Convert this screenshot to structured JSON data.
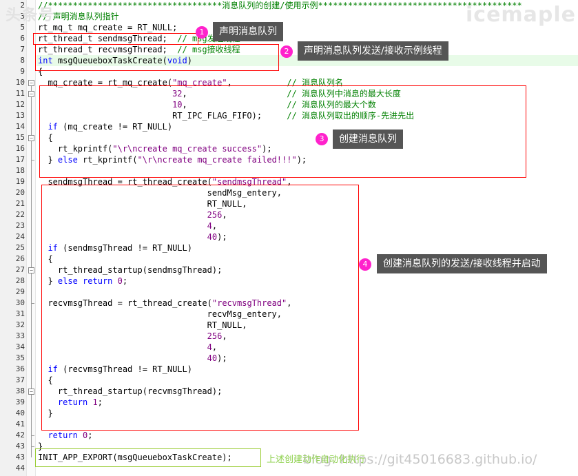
{
  "watermarks": {
    "top_left": "头条号",
    "top_right": "icemaple",
    "bottom": "blog: https://git45016683.github.io/"
  },
  "editor": {
    "lines": [
      {
        "n": "2",
        "html": "<span class=\"cmt\">//***********************************消息队列的创建/使用示例*****************************************</span>"
      },
      {
        "n": "3",
        "html": "<span class=\"cmt\">// 声明消息队列指针</span>"
      },
      {
        "n": "5",
        "html": "rt_mq_t mq_create = RT_NULL;"
      },
      {
        "n": "6",
        "html": "rt_thread_t sendmsgThread;  <span class=\"cmt\">// msg发送线程</span>"
      },
      {
        "n": "7",
        "html": "rt_thread_t recvmsgThread;  <span class=\"cmt\">// msg接收线程</span>"
      },
      {
        "n": "8",
        "html": "<span class=\"kw\">int</span> msgQueueboxTaskCreate(<span class=\"kw\">void</span>)"
      },
      {
        "n": "9",
        "html": "{"
      },
      {
        "n": "10",
        "html": "  mq_create = rt_mq_create(<span class=\"str\">\"mq_create\"</span>,           <span class=\"cmt\">// 消息队列名</span>"
      },
      {
        "n": "11",
        "html": "                           <span class=\"num\">32</span>,                    <span class=\"cmt\">// 消息队列中消息的最大长度</span>"
      },
      {
        "n": "12",
        "html": "                           <span class=\"num\">10</span>,                    <span class=\"cmt\">// 消息队列的最大个数</span>"
      },
      {
        "n": "13",
        "html": "                           RT_IPC_FLAG_FIFO);     <span class=\"cmt\">// 消息队列取出的顺序-先进先出</span>"
      },
      {
        "n": "14",
        "html": "  <span class=\"kw\">if</span> (mq_create != RT_NULL)"
      },
      {
        "n": "15",
        "html": "  {"
      },
      {
        "n": "16",
        "html": "    rt_kprintf(<span class=\"str\">\"\\r\\ncreate mq_create success\"</span>);"
      },
      {
        "n": "17",
        "html": "  } <span class=\"kw\">else</span> rt_kprintf(<span class=\"str\">\"\\r\\ncreate mq_create failed!!!\"</span>);"
      },
      {
        "n": "18",
        "html": ""
      },
      {
        "n": "19",
        "html": "  sendmsgThread = rt_thread_create(<span class=\"str\">\"sendmsgThread\"</span>,"
      },
      {
        "n": "20",
        "html": "                                  sendMsg_entery,"
      },
      {
        "n": "21",
        "html": "                                  RT_NULL,"
      },
      {
        "n": "22",
        "html": "                                  <span class=\"num\">256</span>,"
      },
      {
        "n": "23",
        "html": "                                  <span class=\"num\">4</span>,"
      },
      {
        "n": "24",
        "html": "                                  <span class=\"num\">40</span>);"
      },
      {
        "n": "25",
        "html": "  <span class=\"kw\">if</span> (sendmsgThread != RT_NULL)"
      },
      {
        "n": "26",
        "html": "  {"
      },
      {
        "n": "27",
        "html": "    rt_thread_startup(sendmsgThread);"
      },
      {
        "n": "28",
        "html": "  } <span class=\"kw\">else</span> <span class=\"kw\">return</span> <span class=\"num\">0</span>;"
      },
      {
        "n": "29",
        "html": ""
      },
      {
        "n": "30",
        "html": "  recvmsgThread = rt_thread_create(<span class=\"str\">\"recvmsgThread\"</span>,"
      },
      {
        "n": "31",
        "html": "                                  recvMsg_entery,"
      },
      {
        "n": "32",
        "html": "                                  RT_NULL,"
      },
      {
        "n": "33",
        "html": "                                  <span class=\"num\">256</span>,"
      },
      {
        "n": "34",
        "html": "                                  <span class=\"num\">4</span>,"
      },
      {
        "n": "35",
        "html": "                                  <span class=\"num\">40</span>);"
      },
      {
        "n": "36",
        "html": "  <span class=\"kw\">if</span> (recvmsgThread != RT_NULL)"
      },
      {
        "n": "37",
        "html": "  {"
      },
      {
        "n": "38",
        "html": "    rt_thread_startup(recvmsgThread);"
      },
      {
        "n": "39",
        "html": "    <span class=\"kw\">return</span> <span class=\"num\">1</span>;"
      },
      {
        "n": "40",
        "html": "  }"
      },
      {
        "n": "41",
        "html": ""
      },
      {
        "n": "42",
        "html": "  <span class=\"kw\">return</span> <span class=\"num\">0</span>;"
      },
      {
        "n": "43",
        "html": "}"
      },
      {
        "n": "43",
        "html": "INIT_APP_EXPORT(msgQueueboxTaskCreate);"
      },
      {
        "n": "44",
        "html": ""
      }
    ]
  },
  "annotations": [
    {
      "badge": "1",
      "label": "声明消息队列"
    },
    {
      "badge": "2",
      "label": "声明消息队列发送/接收示例线程"
    },
    {
      "badge": "3",
      "label": "创建消息队列"
    },
    {
      "badge": "4",
      "label": "创建消息队列的发送/接收线程并启动"
    }
  ],
  "footer_note": "上述创建动作自动化执行",
  "colors": {
    "keyword": "#0000ff",
    "string": "#800080",
    "comment": "#008000",
    "box_red": "#ff0000",
    "box_green": "#99cc33",
    "badge": "#ff22cc",
    "callout": "#555555"
  }
}
